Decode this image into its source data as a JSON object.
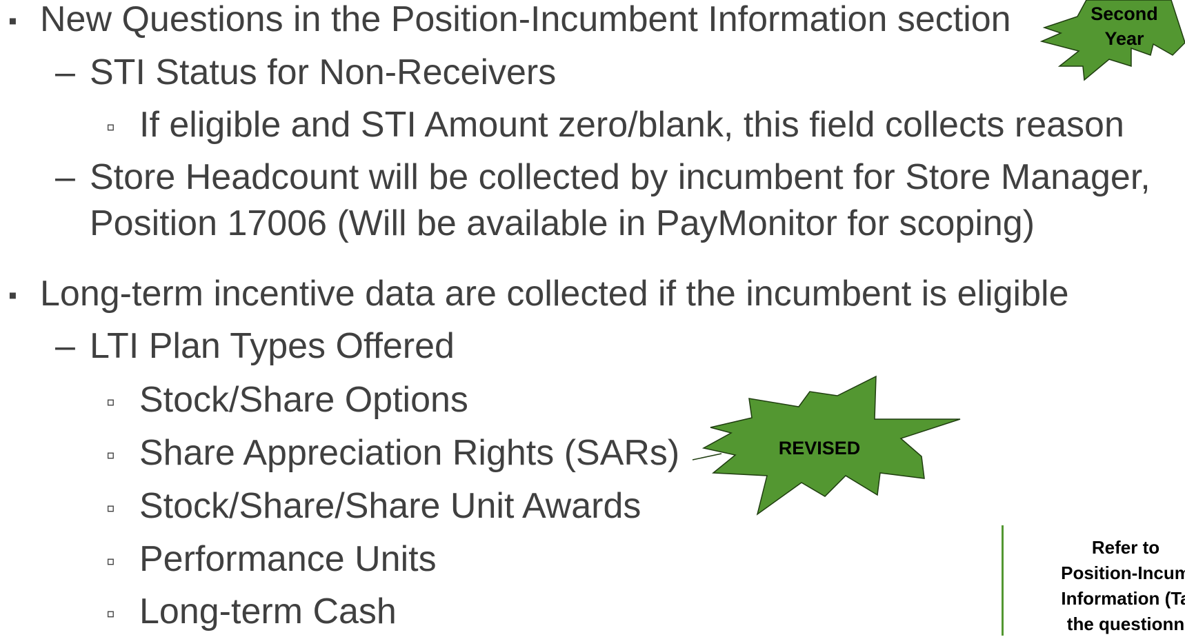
{
  "bullets": {
    "level1_marker": "▪",
    "level2_marker": "–",
    "level3_marker": "▫"
  },
  "content": {
    "item1": "New Questions in the Position-Incumbent Information section",
    "item1_sub1": "STI Status for Non-Receivers",
    "item1_sub1_detail": "If eligible and STI Amount zero/blank, this field collects reason",
    "item1_sub2_line1": "Store Headcount will be collected by incumbent for Store Manager,",
    "item1_sub2_line2": "Position 17006 (Will be available in PayMonitor for scoping)",
    "item2": "Long-term incentive data are collected if the incumbent is eligible",
    "item2_sub1": "LTI Plan Types Offered",
    "lti_plan_types": [
      "Stock/Share Options",
      "Share Appreciation Rights (SARs)",
      "Stock/Share/Share Unit Awards",
      "Performance Units",
      "Long-term Cash"
    ]
  },
  "badges": {
    "second_year_line1": "Second",
    "second_year_line2": "Year",
    "revised": "REVISED"
  },
  "side_note": {
    "line1": "Refer to",
    "line2": "Position-Incum",
    "line3": "Information (Ta",
    "line4": "the questionn"
  },
  "colors": {
    "text": "#404040",
    "badge_fill": "#539731",
    "badge_stroke": "#1f3d10",
    "side_rule": "#539731"
  }
}
